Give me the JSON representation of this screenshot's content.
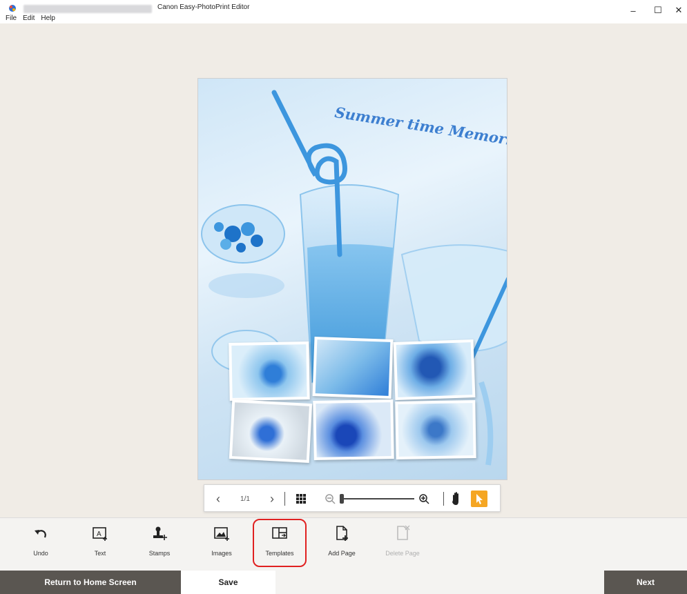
{
  "window": {
    "title": "Canon Easy-PhotoPrint Editor",
    "minimize": "–",
    "maximize": "☐",
    "close": "✕"
  },
  "menu": [
    "File",
    "Edit",
    "Help"
  ],
  "page": {
    "title": "Summer time Memories"
  },
  "navbar": {
    "prev": "‹",
    "page_indicator": "1/1",
    "next": "›",
    "grid_icon": "grid-icon",
    "zoom_out_icon": "zoom-out-icon",
    "zoom_in_icon": "zoom-in-icon",
    "pan_icon": "hand-icon",
    "select_icon": "pointer-icon",
    "zoom_level": 0.0
  },
  "toolbar": {
    "items": [
      {
        "label": "Undo",
        "icon": "undo-icon"
      },
      {
        "label": "Text",
        "icon": "text-icon"
      },
      {
        "label": "Stamps",
        "icon": "stamp-icon"
      },
      {
        "label": "Images",
        "icon": "images-icon"
      },
      {
        "label": "Templates",
        "icon": "templates-icon"
      },
      {
        "label": "Add Page",
        "icon": "add-page-icon"
      },
      {
        "label": "Delete Page",
        "icon": "delete-page-icon"
      }
    ]
  },
  "bottom": {
    "home": "Return to Home Screen",
    "save": "Save",
    "next": "Next"
  },
  "colors": {
    "accent_orange": "#f5a623",
    "highlight_red": "#e02020",
    "dark_button": "#5a5651"
  }
}
